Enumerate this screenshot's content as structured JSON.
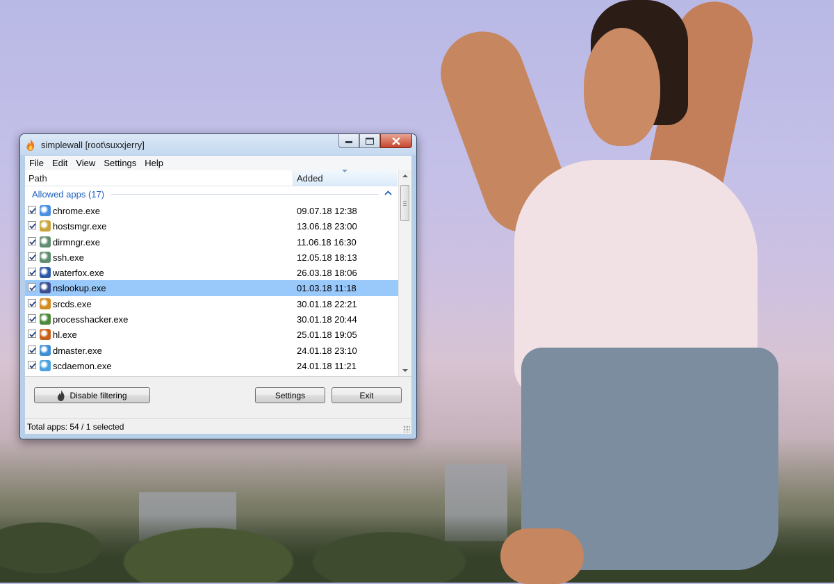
{
  "window": {
    "title": "simplewall [root\\suxxjerry]"
  },
  "menu": [
    "File",
    "Edit",
    "View",
    "Settings",
    "Help"
  ],
  "list": {
    "columns": {
      "path": "Path",
      "added": "Added"
    },
    "group_label": "Allowed apps (17)",
    "rows": [
      {
        "name": "chrome.exe",
        "added": "09.07.18 12:38",
        "checked": true,
        "icon": "chrome-icon",
        "icon_color": "#4a8fe0",
        "selected": false
      },
      {
        "name": "hostsmgr.exe",
        "added": "13.06.18 23:00",
        "checked": true,
        "icon": "hostsmgr-icon",
        "icon_color": "#c9a43c",
        "selected": false
      },
      {
        "name": "dirmngr.exe",
        "added": "11.06.18 16:30",
        "checked": true,
        "icon": "terminal-icon",
        "icon_color": "#5f8d6f",
        "selected": false
      },
      {
        "name": "ssh.exe",
        "added": "12.05.18 18:13",
        "checked": true,
        "icon": "terminal-icon",
        "icon_color": "#5f8d6f",
        "selected": false
      },
      {
        "name": "waterfox.exe",
        "added": "26.03.18 18:06",
        "checked": true,
        "icon": "waterfox-icon",
        "icon_color": "#2d5aa6",
        "selected": false
      },
      {
        "name": "nslookup.exe",
        "added": "01.03.18 11:18",
        "checked": true,
        "icon": "network-icon",
        "icon_color": "#3b4e8f",
        "selected": true
      },
      {
        "name": "srcds.exe",
        "added": "30.01.18 22:21",
        "checked": true,
        "icon": "half-life-icon",
        "icon_color": "#d38a1f",
        "selected": false
      },
      {
        "name": "processhacker.exe",
        "added": "30.01.18 20:44",
        "checked": true,
        "icon": "processhacker-icon",
        "icon_color": "#4c8a3a",
        "selected": false
      },
      {
        "name": "hl.exe",
        "added": "25.01.18 19:05",
        "checked": true,
        "icon": "half-life-icon",
        "icon_color": "#c9601a",
        "selected": false
      },
      {
        "name": "dmaster.exe",
        "added": "24.01.18 23:10",
        "checked": true,
        "icon": "download-master-icon",
        "icon_color": "#3f8fd6",
        "selected": false
      },
      {
        "name": "scdaemon.exe",
        "added": "24.01.18 11:21",
        "checked": true,
        "icon": "scdaemon-icon",
        "icon_color": "#4aa2de",
        "selected": false
      }
    ]
  },
  "buttons": {
    "disable_filtering": "Disable filtering",
    "settings": "Settings",
    "exit": "Exit"
  },
  "status": "Total apps: 54 / 1 selected",
  "colors": {
    "selection": "#99c8fa",
    "group_text": "#1e5fbf",
    "titlebar": "#c4d8ef"
  }
}
